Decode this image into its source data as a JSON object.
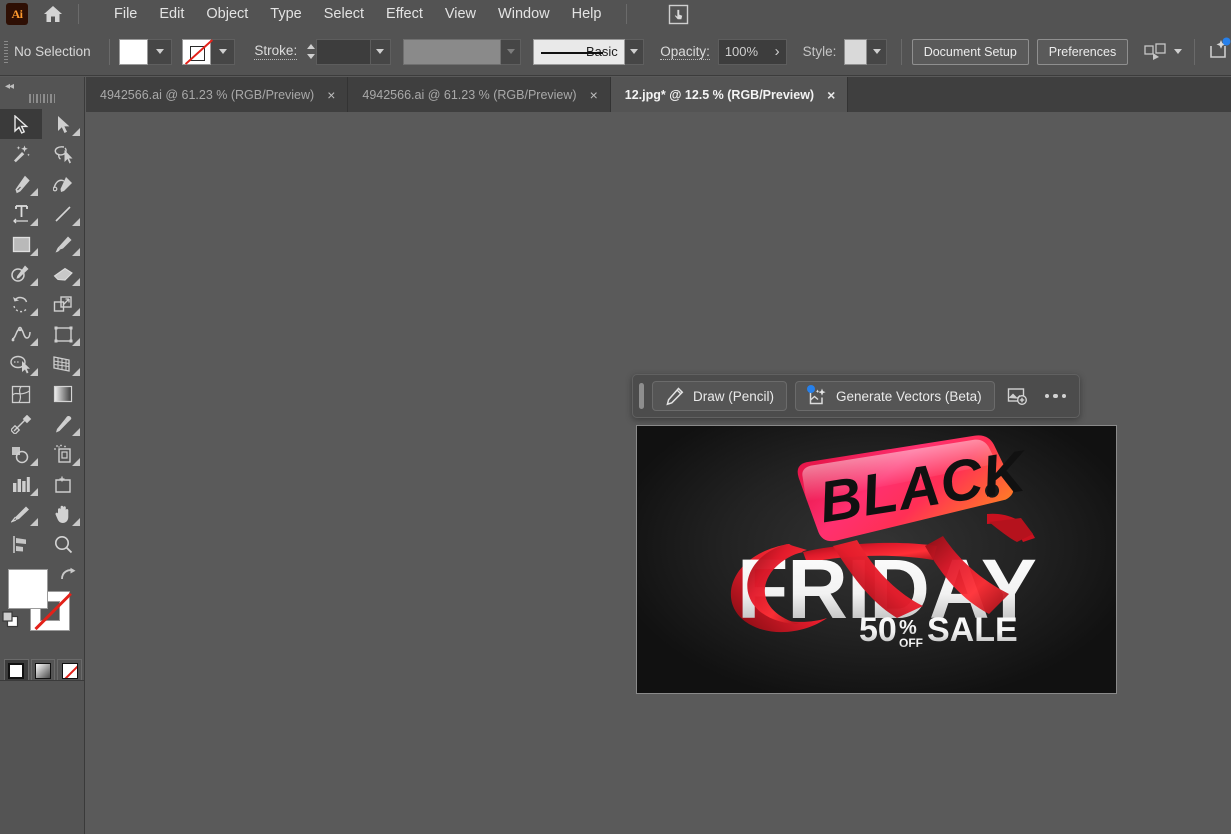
{
  "app": {
    "name": "Adobe Illustrator",
    "logo_text": "Ai",
    "accent_blue": "#2680eb",
    "brand_orange": "#ff9a2e"
  },
  "menubar": {
    "home_icon": "home-icon",
    "touch_icon": "touch-type-tool-icon",
    "items": [
      {
        "label": "File"
      },
      {
        "label": "Edit"
      },
      {
        "label": "Object"
      },
      {
        "label": "Type"
      },
      {
        "label": "Select"
      },
      {
        "label": "Effect"
      },
      {
        "label": "View"
      },
      {
        "label": "Window"
      },
      {
        "label": "Help"
      }
    ]
  },
  "controlbar": {
    "selection_status": "No Selection",
    "fill_swatch": {
      "name": "fill-swatch",
      "color": "#ffffff"
    },
    "stroke_swatch": {
      "name": "stroke-swatch",
      "color": "none"
    },
    "stroke_label": "Stroke:",
    "stroke_weight": "",
    "variable_width": "",
    "stroke_profile": "Basic",
    "opacity_label": "Opacity:",
    "opacity_value": "100%",
    "opacity_more": "›",
    "style_label": "Style:",
    "style_swatch_color": "#d9d9d9",
    "document_setup_label": "Document Setup",
    "preferences_label": "Preferences",
    "arrange_icon": "arrange-documents-icon",
    "share_icon": "share-document-icon"
  },
  "tabs": [
    {
      "label": "4942566.ai @ 61.23 % (RGB/Preview)",
      "active": false,
      "close": "×"
    },
    {
      "label": "4942566.ai @ 61.23 % (RGB/Preview)",
      "active": false,
      "close": "×"
    },
    {
      "label": "12.jpg* @ 12.5 % (RGB/Preview)",
      "active": true,
      "close": "×"
    }
  ],
  "toolbar": {
    "collapse_icon": "collapse-panel-icon",
    "tools": [
      {
        "name": "selection-tool",
        "icon": "arrow-cursor-icon",
        "selected": true,
        "more": false
      },
      {
        "name": "direct-selection-tool",
        "icon": "white-arrow-icon",
        "selected": false,
        "more": true
      },
      {
        "name": "magic-wand-tool",
        "icon": "magic-wand-icon",
        "selected": false,
        "more": false
      },
      {
        "name": "lasso-tool",
        "icon": "lasso-icon",
        "selected": false,
        "more": false
      },
      {
        "name": "pen-tool",
        "icon": "pen-icon",
        "selected": false,
        "more": true
      },
      {
        "name": "curvature-tool",
        "icon": "curvature-icon",
        "selected": false,
        "more": false
      },
      {
        "name": "type-tool",
        "icon": "type-t-icon",
        "selected": false,
        "more": true
      },
      {
        "name": "line-segment-tool",
        "icon": "line-segment-icon",
        "selected": false,
        "more": true
      },
      {
        "name": "rectangle-tool",
        "icon": "rectangle-icon",
        "selected": false,
        "more": true
      },
      {
        "name": "paintbrush-tool",
        "icon": "paintbrush-icon",
        "selected": false,
        "more": true
      },
      {
        "name": "shaper-tool",
        "icon": "shaper-pencil-icon",
        "selected": false,
        "more": true
      },
      {
        "name": "eraser-tool",
        "icon": "eraser-icon",
        "selected": false,
        "more": true
      },
      {
        "name": "rotate-tool",
        "icon": "rotate-icon",
        "selected": false,
        "more": true
      },
      {
        "name": "scale-tool",
        "icon": "scale-icon",
        "selected": false,
        "more": true
      },
      {
        "name": "width-tool",
        "icon": "width-warp-icon",
        "selected": false,
        "more": true
      },
      {
        "name": "free-transform-tool",
        "icon": "free-transform-icon",
        "selected": false,
        "more": true
      },
      {
        "name": "shape-builder-tool",
        "icon": "shape-builder-icon",
        "selected": false,
        "more": true
      },
      {
        "name": "perspective-grid-tool",
        "icon": "perspective-grid-icon",
        "selected": false,
        "more": true
      },
      {
        "name": "mesh-tool",
        "icon": "mesh-icon",
        "selected": false,
        "more": false
      },
      {
        "name": "gradient-tool",
        "icon": "gradient-icon",
        "selected": false,
        "more": false
      },
      {
        "name": "blend-tool",
        "icon": "blend-icon",
        "selected": false,
        "more": false
      },
      {
        "name": "eyedropper-tool",
        "icon": "eyedropper-icon",
        "selected": false,
        "more": true
      },
      {
        "name": "symbol-sprayer-tool",
        "icon": "symbol-sprayer-icon",
        "selected": false,
        "more": true
      },
      {
        "name": "column-graph-tool",
        "icon": "bar-chart-icon",
        "selected": false,
        "more": true
      },
      {
        "name": "artboard-tool",
        "icon": "artboard-icon",
        "selected": false,
        "more": false
      },
      {
        "name": "slice-tool",
        "icon": "slice-knife-icon",
        "selected": false,
        "more": true
      },
      {
        "name": "hand-tool",
        "icon": "hand-icon",
        "selected": false,
        "more": true
      },
      {
        "name": "align-tool",
        "icon": "align-icon",
        "selected": false,
        "more": false
      },
      {
        "name": "zoom-tool",
        "icon": "magnifier-icon",
        "selected": false,
        "more": false
      }
    ],
    "color": {
      "fill_name": "fill-color-swatch",
      "fill_color": "#ffffff",
      "stroke_name": "stroke-color-swatch",
      "stroke_color": "none",
      "swap_icon": "swap-fill-stroke-icon",
      "default_icon": "default-fill-stroke-icon"
    },
    "paint_modes": [
      {
        "name": "color-mode-button",
        "icon": "solid-color-icon",
        "selected": true
      },
      {
        "name": "gradient-mode-button",
        "icon": "gradient-swatch-icon",
        "selected": false
      },
      {
        "name": "none-mode-button",
        "icon": "no-color-icon",
        "selected": false
      }
    ],
    "draw_modes": [
      {
        "name": "draw-normal-button",
        "icon": "draw-normal-icon",
        "selected": true,
        "disabled": false
      },
      {
        "name": "draw-behind-button",
        "icon": "draw-behind-icon",
        "selected": false,
        "disabled": false
      },
      {
        "name": "draw-inside-button",
        "icon": "draw-inside-icon",
        "selected": false,
        "disabled": true
      }
    ],
    "screen_mode": {
      "name": "change-screen-mode-button",
      "icon": "screen-mode-icon"
    },
    "more_tools": {
      "name": "edit-toolbar-button",
      "icon": "more-dots-icon"
    }
  },
  "context_toolbar": {
    "grip": "drag-handle",
    "buttons": [
      {
        "name": "draw-pencil-button",
        "label": "Draw (Pencil)",
        "icon": "pencil-icon",
        "beta": false
      },
      {
        "name": "generate-vectors-button",
        "label": "Generate Vectors (Beta)",
        "icon": "generate-vectors-icon",
        "beta": true
      }
    ],
    "image_button": {
      "name": "place-image-button",
      "icon": "image-add-icon"
    },
    "more_button": {
      "name": "more-options-button",
      "icon": "more-dots-icon"
    }
  },
  "artwork": {
    "name": "black-friday-sale-banner",
    "background": "#141414",
    "tag_text": "BLACK",
    "main_text": "FRIDAY",
    "discount_number": "50",
    "discount_percent": "%",
    "discount_off": "OFF",
    "sale_text": "SALE",
    "tag_gradient_start": "#e8174c",
    "tag_gradient_mid": "#ff2d6b",
    "tag_gradient_end": "#ff6a2a",
    "ribbon_color": "#d4182a",
    "text_color": "#ffffff"
  }
}
